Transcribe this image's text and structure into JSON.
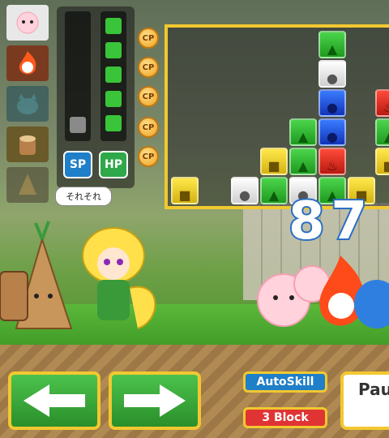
{
  "hud": {
    "gauges": {
      "sp_label": "SP",
      "hp_label": "HP",
      "sp_fill": 0.2,
      "hp_fill": 1.0
    },
    "cp_label": "CP",
    "score": "87"
  },
  "characters": {
    "speech_bubble": "それそれ"
  },
  "controls": {
    "autoskill_label": "AutoSkill",
    "block_label": "3 Block",
    "pause_label": "Pau"
  },
  "colors": {
    "board_border": "#f2c830",
    "sp_button": "#1f7fc8",
    "hp_button": "#2fa84a",
    "autoskill_button": "#1f7fc8",
    "block_button": "#e03434",
    "score_outline": "#2a6fc4"
  }
}
